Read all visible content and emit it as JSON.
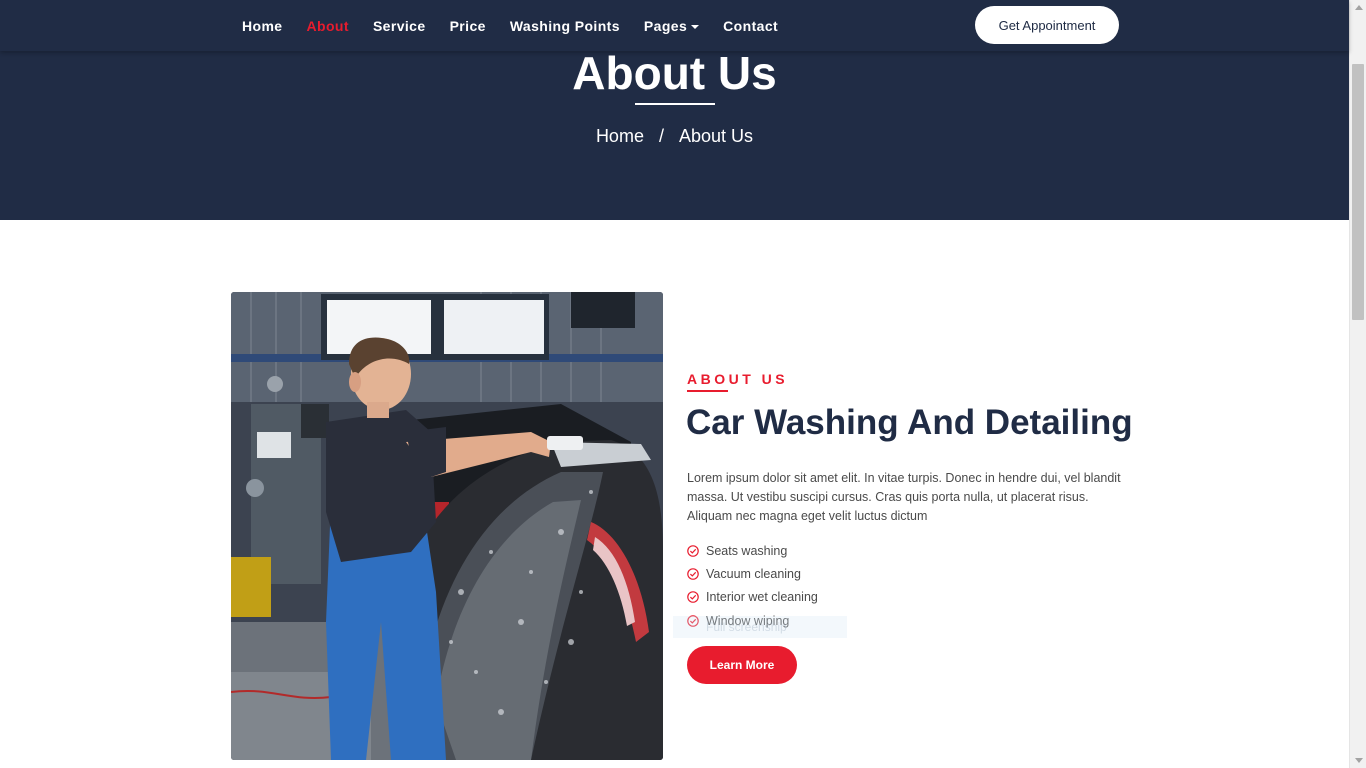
{
  "nav": {
    "items": [
      {
        "label": "Home",
        "active": false
      },
      {
        "label": "About",
        "active": true
      },
      {
        "label": "Service",
        "active": false
      },
      {
        "label": "Price",
        "active": false
      },
      {
        "label": "Washing Points",
        "active": false
      },
      {
        "label": "Pages",
        "active": false,
        "dropdown": true
      },
      {
        "label": "Contact",
        "active": false
      }
    ],
    "cta_label": "Get Appointment"
  },
  "hero": {
    "title": "About Us",
    "breadcrumb": [
      "Home",
      "About Us"
    ],
    "separator": "/"
  },
  "about": {
    "label": "ABOUT US",
    "title": "Car Washing And Detailing",
    "description": "Lorem ipsum dolor sit amet elit. In vitae turpis. Donec in hendre dui, vel blandit massa. Ut vestibu suscipi cursus. Cras quis porta nulla, ut placerat risus. Aliquam nec magna eget velit luctus dictum",
    "features": [
      "Seats washing",
      "Vacuum cleaning",
      "Interior wet cleaning",
      "Window wiping"
    ],
    "ghost_text": "Full screenship",
    "button_label": "Learn More"
  },
  "colors": {
    "navy": "#202c45",
    "accent_red": "#e81c2e"
  }
}
